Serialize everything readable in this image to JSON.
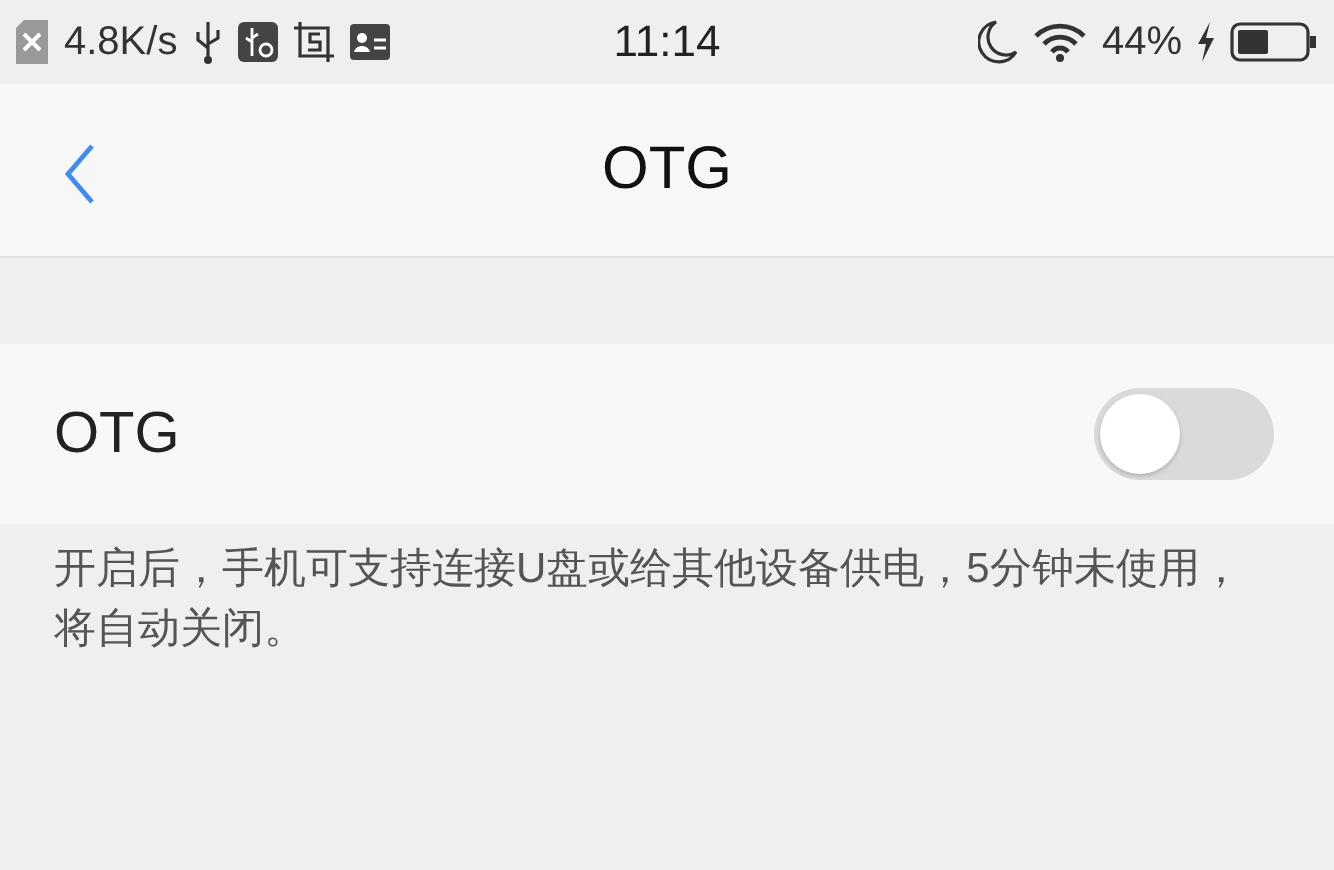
{
  "status_bar": {
    "speed": "4.8K/s",
    "time": "11:14",
    "battery": "44%"
  },
  "nav": {
    "title": "OTG"
  },
  "setting": {
    "label": "OTG",
    "on": false
  },
  "description": "开启后，手机可支持连接U盘或给其他设备供电，5分钟未使用，将自动关闭。"
}
